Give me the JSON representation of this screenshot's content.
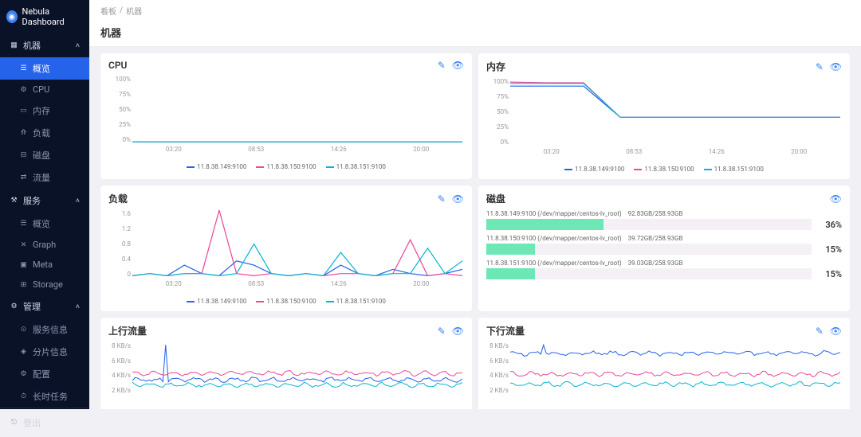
{
  "brand": "Nebula Dashboard",
  "breadcrumb": {
    "root": "看板",
    "sep": "/",
    "current": "机器"
  },
  "page_title": "机器",
  "sidebar": {
    "sections": [
      {
        "title": "机器",
        "icon": "machine-icon",
        "items": [
          {
            "label": "概览",
            "icon": "overview-icon",
            "active": true
          },
          {
            "label": "CPU",
            "icon": "cpu-icon"
          },
          {
            "label": "内存",
            "icon": "memory-icon"
          },
          {
            "label": "负载",
            "icon": "load-icon"
          },
          {
            "label": "磁盘",
            "icon": "disk-icon"
          },
          {
            "label": "流量",
            "icon": "traffic-icon"
          }
        ]
      },
      {
        "title": "服务",
        "icon": "service-icon",
        "items": [
          {
            "label": "概览",
            "icon": "overview-icon"
          },
          {
            "label": "Graph",
            "icon": "graph-icon"
          },
          {
            "label": "Meta",
            "icon": "meta-icon"
          },
          {
            "label": "Storage",
            "icon": "storage-icon"
          }
        ]
      },
      {
        "title": "管理",
        "icon": "manage-icon",
        "items": [
          {
            "label": "服务信息",
            "icon": "info-icon"
          },
          {
            "label": "分片信息",
            "icon": "shard-icon"
          },
          {
            "label": "配置",
            "icon": "config-icon"
          },
          {
            "label": "长时任务",
            "icon": "task-icon"
          }
        ]
      }
    ],
    "logout": "登出"
  },
  "cards": {
    "cpu": {
      "title": "CPU"
    },
    "memory": {
      "title": "内存"
    },
    "load": {
      "title": "负载"
    },
    "disk": {
      "title": "磁盘"
    },
    "upstream": {
      "title": "上行流量"
    },
    "downstream": {
      "title": "下行流量"
    }
  },
  "colors": {
    "s1": "#2563eb",
    "s2": "#ec4899",
    "s3": "#06b6d4"
  },
  "hosts": [
    "11.8.38.149:9100",
    "11.8.38.150:9100",
    "11.8.38.151:9100"
  ],
  "chart_data": {
    "cpu": {
      "type": "line",
      "ylabel": "%",
      "ylim": [
        0,
        100
      ],
      "y_ticks": [
        "100%",
        "75%",
        "50%",
        "25%",
        "0%"
      ],
      "x_ticks": [
        "03:20",
        "08:53",
        "14:26",
        "20:00"
      ],
      "series": [
        {
          "name": "11.8.38.149:9100",
          "color": "#2563eb",
          "values": [
            2,
            2,
            2,
            2,
            2,
            2,
            2,
            2,
            2,
            2
          ]
        },
        {
          "name": "11.8.38.150:9100",
          "color": "#ec4899",
          "values": [
            2,
            2,
            2,
            2,
            2,
            2,
            2,
            2,
            2,
            2
          ]
        },
        {
          "name": "11.8.38.151:9100",
          "color": "#06b6d4",
          "values": [
            2,
            2,
            2,
            2,
            2,
            2,
            2,
            2,
            2,
            2
          ]
        }
      ]
    },
    "memory": {
      "type": "line",
      "ylabel": "%",
      "ylim": [
        0,
        100
      ],
      "y_ticks": [
        "100%",
        "75%",
        "50%",
        "25%",
        "0%"
      ],
      "x_ticks": [
        "03:20",
        "08:53",
        "14:26",
        "20:00"
      ],
      "series": [
        {
          "name": "11.8.38.149:9100",
          "color": "#2563eb",
          "values": [
            88,
            88,
            88,
            42,
            42,
            42,
            42,
            42,
            42,
            42
          ]
        },
        {
          "name": "11.8.38.150:9100",
          "color": "#ec4899",
          "values": [
            94,
            93,
            93,
            42,
            42,
            42,
            42,
            42,
            42,
            42
          ]
        },
        {
          "name": "11.8.38.151:9100",
          "color": "#06b6d4",
          "values": [
            92,
            92,
            92,
            42,
            42,
            42,
            42,
            42,
            42,
            42
          ]
        }
      ]
    },
    "load": {
      "type": "line",
      "ylim": [
        0,
        1.6
      ],
      "y_ticks": [
        "1.6",
        "1.2",
        "0.8",
        "0.4",
        "0"
      ],
      "x_ticks": [
        "03:20",
        "08:53",
        "14:26",
        "20:00"
      ],
      "series": [
        {
          "name": "11.8.38.149:9100",
          "color": "#2563eb",
          "values": [
            0.05,
            0.1,
            0.05,
            0.3,
            0.1,
            0.05,
            0.4,
            0.3,
            0.1,
            0.05,
            0.1,
            0.05,
            0.3,
            0.1,
            0.05,
            0.2,
            0.1,
            0.05,
            0.1,
            0.2
          ]
        },
        {
          "name": "11.8.38.150:9100",
          "color": "#ec4899",
          "values": [
            0.05,
            0.1,
            0.05,
            0.1,
            0.1,
            1.6,
            0.1,
            0.05,
            0.1,
            0.05,
            0.1,
            0.05,
            0.1,
            0.1,
            0.05,
            0.1,
            0.9,
            0.05,
            0.1,
            0.05
          ]
        },
        {
          "name": "11.8.38.151:9100",
          "color": "#06b6d4",
          "values": [
            0.05,
            0.1,
            0.05,
            0.1,
            0.1,
            0.05,
            0.1,
            0.8,
            0.1,
            0.05,
            0.1,
            0.05,
            0.6,
            0.1,
            0.05,
            0.1,
            0.1,
            0.7,
            0.1,
            0.4
          ]
        }
      ]
    },
    "disk": {
      "type": "bar",
      "rows": [
        {
          "host": "11.8.38.149:9100 (/dev/mapper/centos-lv_root)",
          "usage": "92.83GB/258.93GB",
          "pct": 36
        },
        {
          "host": "11.8.38.150:9100 (/dev/mapper/centos-lv_root)",
          "usage": "39.72GB/258.93GB",
          "pct": 15
        },
        {
          "host": "11.8.38.151:9100 (/dev/mapper/centos-lv_root)",
          "usage": "39.03GB/258.93GB",
          "pct": 15
        }
      ]
    },
    "upstream": {
      "type": "line",
      "ylabel": "KB/s",
      "ylim": [
        0,
        8
      ],
      "y_ticks": [
        "8 KB/s",
        "6 KB/s",
        "4 KB/s",
        "2 KB/s"
      ],
      "x_ticks": [],
      "series": [
        {
          "name": "11.8.38.149:9100",
          "color": "#2563eb"
        },
        {
          "name": "11.8.38.150:9100",
          "color": "#ec4899"
        },
        {
          "name": "11.8.38.151:9100",
          "color": "#06b6d4"
        }
      ]
    },
    "downstream": {
      "type": "line",
      "ylabel": "KB/s",
      "ylim": [
        0,
        8
      ],
      "y_ticks": [
        "8 KB/s",
        "6 KB/s",
        "4 KB/s",
        "2 KB/s"
      ],
      "x_ticks": [],
      "series": [
        {
          "name": "11.8.38.149:9100",
          "color": "#2563eb"
        },
        {
          "name": "11.8.38.150:9100",
          "color": "#ec4899"
        },
        {
          "name": "11.8.38.151:9100",
          "color": "#06b6d4"
        }
      ]
    }
  }
}
